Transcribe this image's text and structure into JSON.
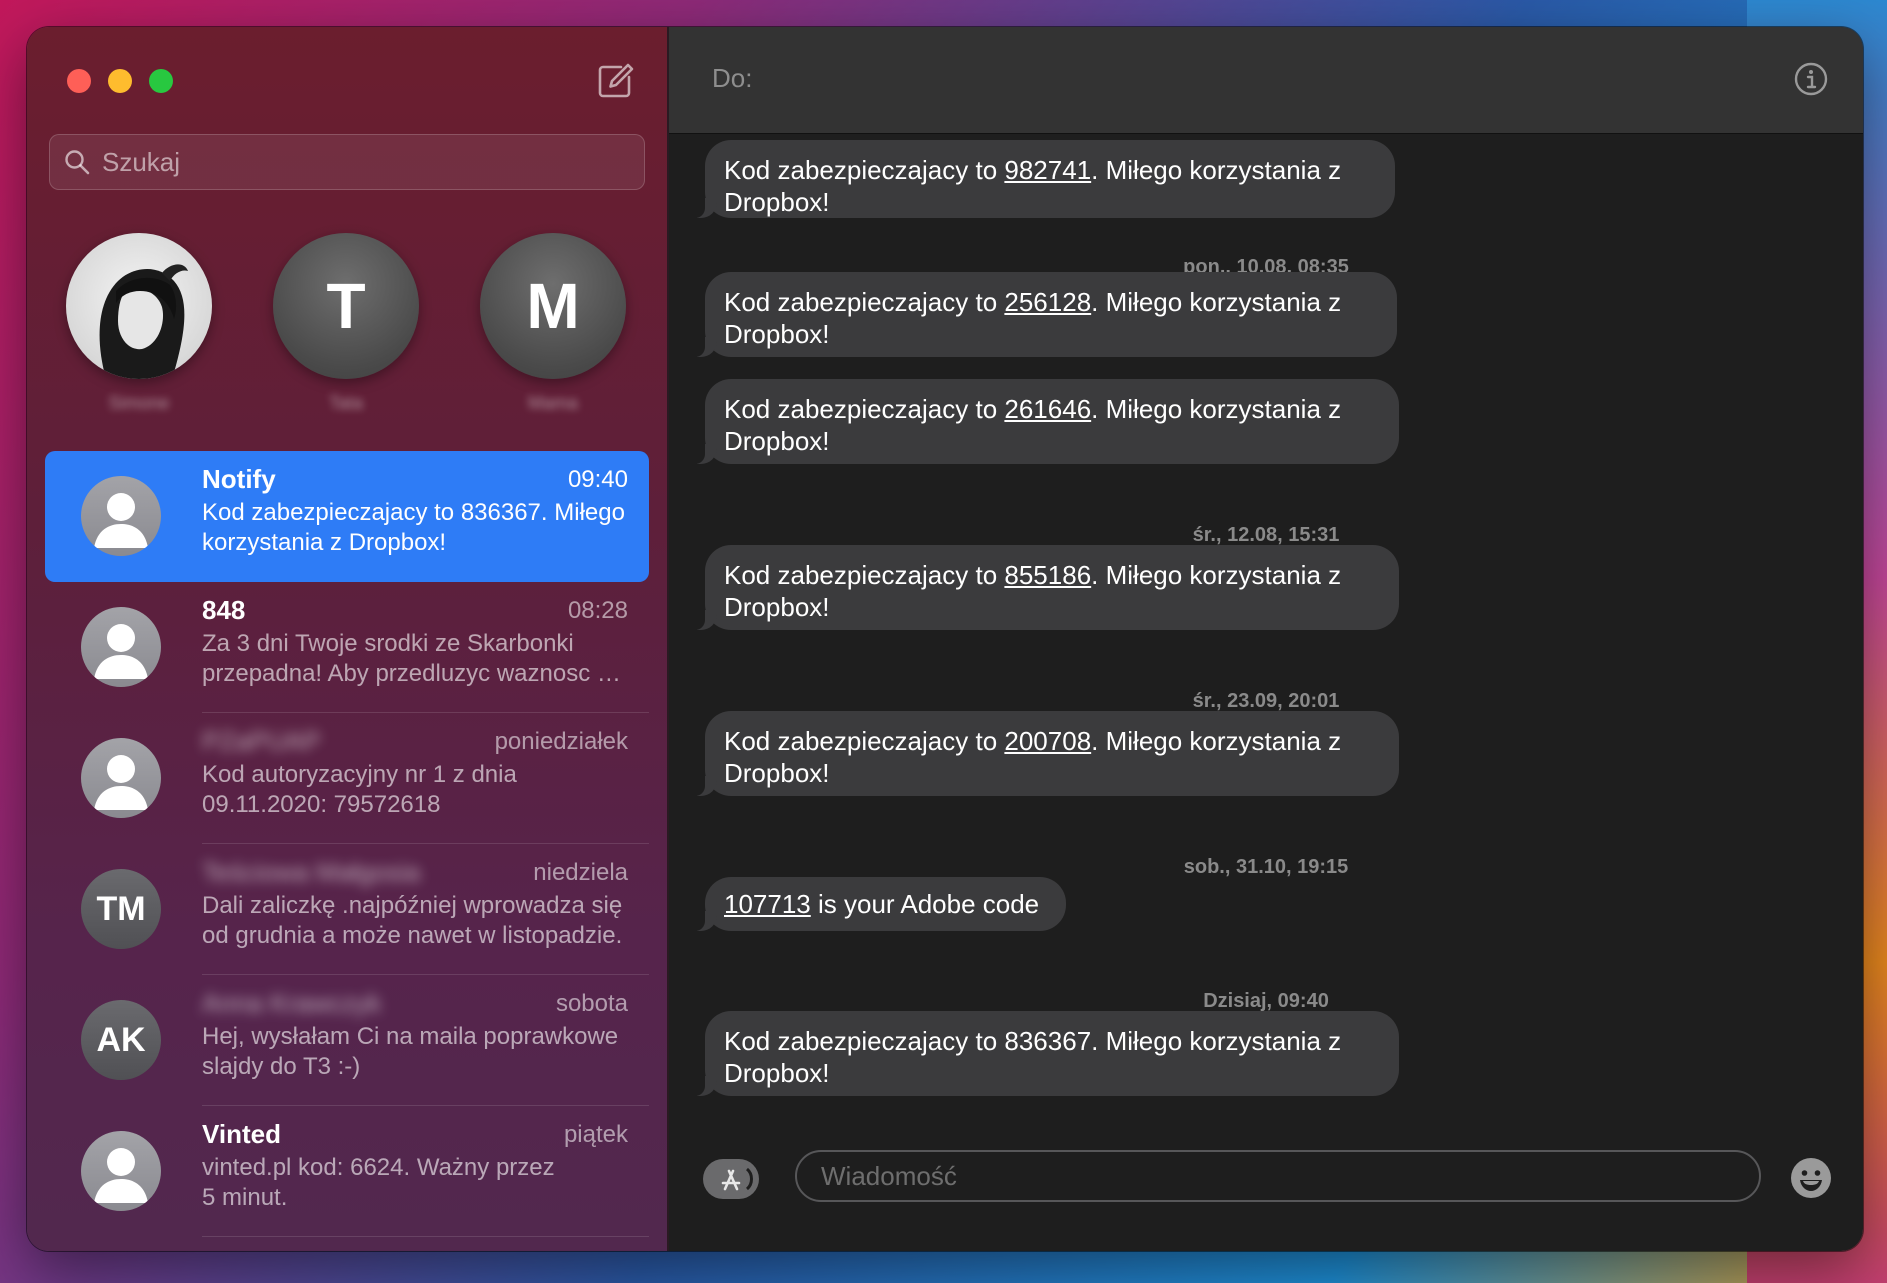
{
  "window_controls": [
    "close",
    "minimize",
    "zoom"
  ],
  "sidebar": {
    "compose_icon": "compose-icon",
    "search": {
      "placeholder": "Szukaj",
      "value": ""
    },
    "pinned": [
      {
        "name": "Simone",
        "initials": "",
        "has_photo": true
      },
      {
        "name": "Tata",
        "initials": "T",
        "has_photo": false
      },
      {
        "name": "Mama",
        "initials": "M",
        "has_photo": false
      }
    ],
    "conversations": [
      {
        "name": "Notify",
        "time": "09:40",
        "preview_1": "Kod zabezpieczajacy to 836367. Miłego",
        "preview_2": "korzystania z Dropbox!",
        "initials": "",
        "selected": true,
        "name_blurred": false
      },
      {
        "name": "848",
        "time": "08:28",
        "preview_1": "Za 3 dni Twoje srodki ze Skarbonki",
        "preview_2": "przepadna! Aby przedluzyc waznosc sr...",
        "initials": "",
        "selected": false,
        "name_blurred": false
      },
      {
        "name": "PZaPUAP",
        "time": "poniedziałek",
        "preview_1": "Kod autoryzacyjny nr 1 z dnia",
        "preview_2": "09.11.2020: 79572618",
        "initials": "",
        "selected": false,
        "name_blurred": true
      },
      {
        "name": "Teściowa Małgosia",
        "time": "niedziela",
        "preview_1": "Dali zaliczkę .najpóźniej wprowadza się",
        "preview_2": "od grudnia a może nawet w listopadzie.",
        "initials": "TM",
        "selected": false,
        "name_blurred": true
      },
      {
        "name": "Anna Krawczyk",
        "time": "sobota",
        "preview_1": "Hej, wysłałam Ci na maila poprawkowe",
        "preview_2": "slajdy do T3 :-)",
        "initials": "AK",
        "selected": false,
        "name_blurred": true
      },
      {
        "name": "Vinted",
        "time": "piątek",
        "preview_1": "vinted.pl kod: 6624. Ważny przez",
        "preview_2": "5 minut.",
        "initials": "",
        "selected": false,
        "name_blurred": false
      }
    ]
  },
  "chat": {
    "to_label": "Do:",
    "info_icon": "info-icon",
    "messages": [
      {
        "before": "Kod zabezpieczajacy to ",
        "code": "982741",
        "after": ". Miłego korzystania z",
        "line2": "Dropbox!"
      },
      {
        "timestamp": "pon., 10.08, 08:35"
      },
      {
        "before": "Kod zabezpieczajacy to ",
        "code": "256128",
        "after": ". Miłego korzystania z",
        "line2": "Dropbox!"
      },
      {
        "before": "Kod zabezpieczajacy to ",
        "code": "261646",
        "after": ". Miłego korzystania z",
        "line2": "Dropbox!"
      },
      {
        "timestamp": "śr., 12.08, 15:31"
      },
      {
        "before": "Kod zabezpieczajacy to ",
        "code": "855186",
        "after": ". Miłego korzystania z",
        "line2": "Dropbox!"
      },
      {
        "timestamp": "śr., 23.09, 20:01"
      },
      {
        "before": "Kod zabezpieczajacy to ",
        "code": "200708",
        "after": ". Miłego korzystania z",
        "line2": "Dropbox!"
      },
      {
        "timestamp": "sob., 31.10, 19:15"
      },
      {
        "before": "",
        "code": "107713",
        "after": " is your Adobe code",
        "line2": ""
      },
      {
        "timestamp": "Dzisiaj, 09:40"
      },
      {
        "before": "Kod zabezpieczajacy to 836367. Miłego korzystania z",
        "code": "",
        "after": "",
        "line2": "Dropbox!"
      }
    ],
    "composer": {
      "apps_icon": "app-store-icon",
      "placeholder": "Wiadomość",
      "value": "",
      "emoji_icon": "emoji-icon"
    }
  },
  "colors": {
    "selected_row": "#2e7cf6",
    "bubble": "#3b3b3d",
    "chat_bg": "#1e1e1e",
    "header_bg": "#333333"
  }
}
